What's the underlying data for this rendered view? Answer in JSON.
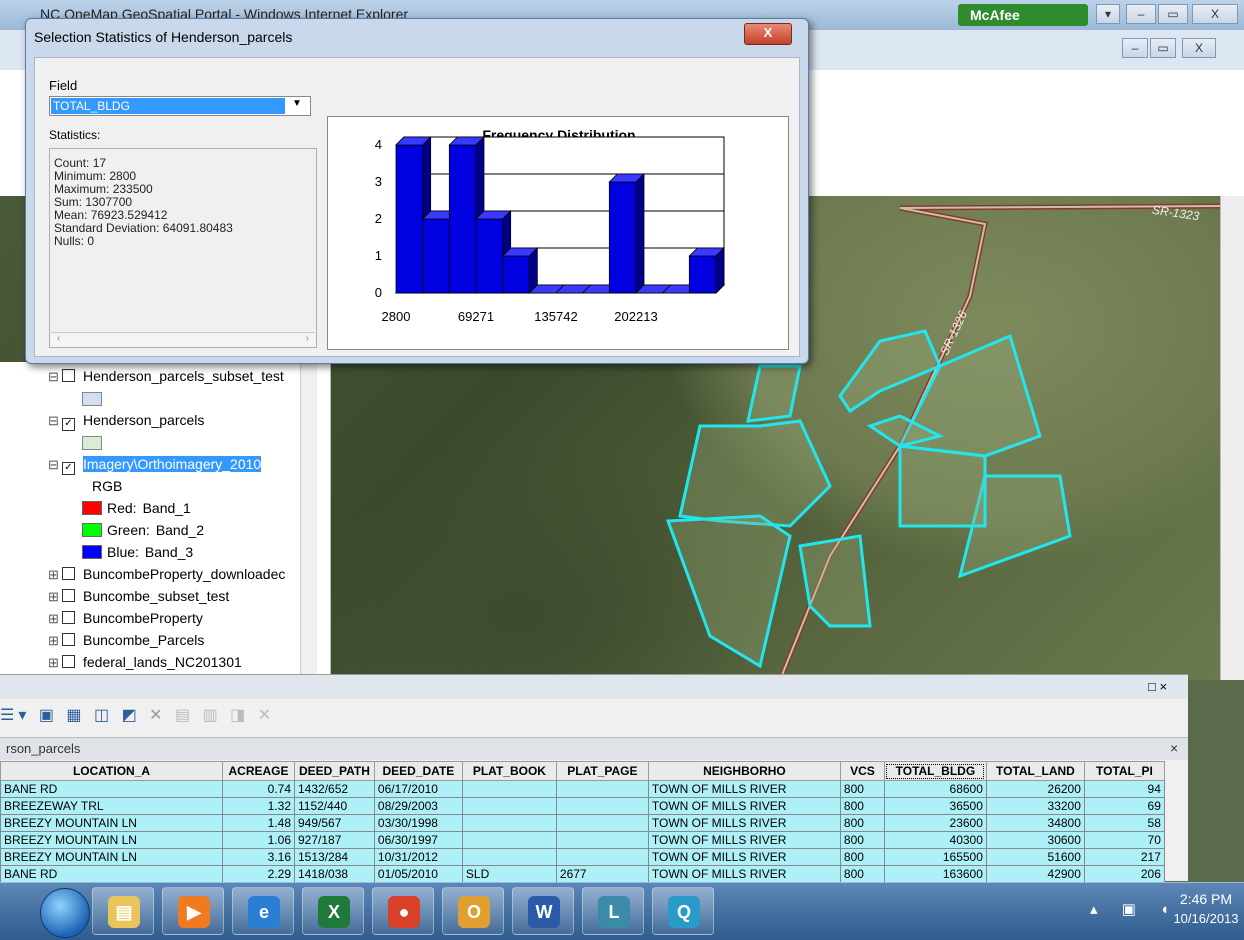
{
  "browser": {
    "title": "NC OneMap GeoSpatial Portal - Windows Internet Explorer",
    "mcafee_label": "McAfee",
    "controls": {
      "minimize": "–",
      "restore": "▭",
      "close": "X"
    }
  },
  "map": {
    "road_labels": [
      "SR-1323",
      "SR-1326"
    ]
  },
  "dialog": {
    "title": "Selection Statistics of Henderson_parcels",
    "close_label": "X",
    "field_label": "Field",
    "field_value": "TOTAL_BLDG",
    "statistics_label": "Statistics:",
    "stats": [
      {
        "label": "Count:",
        "value": "17"
      },
      {
        "label": "Minimum:",
        "value": "2800"
      },
      {
        "label": "Maximum:",
        "value": "233500"
      },
      {
        "label": "Sum:",
        "value": "1307700"
      },
      {
        "label": "Mean:",
        "value": "76923.529412"
      },
      {
        "label": "Standard Deviation:",
        "value": "64091.80483"
      },
      {
        "label": "Nulls:",
        "value": "0"
      }
    ]
  },
  "chart_data": {
    "type": "bar",
    "title": "Frequency Distribution",
    "values": [
      4,
      2,
      4,
      2,
      1,
      0,
      0,
      0,
      3,
      0,
      0,
      1
    ],
    "y_ticks": [
      0,
      1,
      2,
      3,
      4
    ],
    "ylim": [
      0,
      4
    ],
    "x_tick_labels": [
      "2800",
      "69271",
      "135742",
      "202213"
    ],
    "bar_color": "#0000e0",
    "grid": true
  },
  "toc": {
    "layers": [
      {
        "name": "Henderson_parcels_subset_test",
        "checked": false,
        "expander": "⊟",
        "swatch": "#cfe0f0"
      },
      {
        "name": "Henderson_parcels",
        "checked": true,
        "expander": "⊟",
        "swatch": "#d8ecd8"
      },
      {
        "name": "Imagery\\Orthoimagery_2010",
        "checked": true,
        "expander": "⊟",
        "selected": true
      },
      {
        "name": "BuncombeProperty_downloadec",
        "checked": false,
        "expander": "⊞"
      },
      {
        "name": "Buncombe_subset_test",
        "checked": false,
        "expander": "⊞"
      },
      {
        "name": "BuncombeProperty",
        "checked": false,
        "expander": "⊞"
      },
      {
        "name": "Buncombe_Parcels",
        "checked": false,
        "expander": "⊞"
      },
      {
        "name": "federal_lands_NC201301",
        "checked": false,
        "expander": "⊞"
      }
    ],
    "rgb_label": "RGB",
    "bands": [
      {
        "label": "Red:",
        "band": "Band_1",
        "color": "#ff0000"
      },
      {
        "label": "Green:",
        "band": "Band_2",
        "color": "#00ff00"
      },
      {
        "label": "Blue:",
        "band": "Band_3",
        "color": "#0000ff"
      }
    ]
  },
  "table": {
    "window_close": "□ ×",
    "tab_name": "rson_parcels",
    "tab_close": "×",
    "columns": [
      "LOCATION_A",
      "ACREAGE",
      "DEED_PATH",
      "DEED_DATE",
      "PLAT_BOOK",
      "PLAT_PAGE",
      "NEIGHBORHO",
      "VCS",
      "TOTAL_BLDG",
      "TOTAL_LAND",
      "TOTAL_PI"
    ],
    "rows": [
      [
        "BANE RD",
        "0.74",
        "1432/652",
        "06/17/2010",
        "",
        "",
        "TOWN OF MILLS RIVER",
        "800",
        "68600",
        "26200",
        "94"
      ],
      [
        "BREEZEWAY TRL",
        "1.32",
        "1152/440",
        "08/29/2003",
        "",
        "",
        "TOWN OF MILLS RIVER",
        "800",
        "36500",
        "33200",
        "69"
      ],
      [
        "BREEZY MOUNTAIN LN",
        "1.48",
        "949/567",
        "03/30/1998",
        "",
        "",
        "TOWN OF MILLS RIVER",
        "800",
        "23600",
        "34800",
        "58"
      ],
      [
        "BREEZY MOUNTAIN LN",
        "1.06",
        "927/187",
        "06/30/1997",
        "",
        "",
        "TOWN OF MILLS RIVER",
        "800",
        "40300",
        "30600",
        "70"
      ],
      [
        "BREEZY MOUNTAIN LN",
        "3.16",
        "1513/284",
        "10/31/2012",
        "",
        "",
        "TOWN OF MILLS RIVER",
        "800",
        "165500",
        "51600",
        "217"
      ],
      [
        "BANE RD",
        "2.29",
        "1418/038",
        "01/05/2010",
        "SLD",
        "2677",
        "TOWN OF MILLS RIVER",
        "800",
        "163600",
        "42900",
        "206"
      ]
    ]
  },
  "taskbar": {
    "time": "2:46 PM",
    "date": "10/16/2013",
    "apps": [
      {
        "name": "explorer",
        "color": "#e8c45a",
        "glyph": "▤"
      },
      {
        "name": "media",
        "color": "#f07a20",
        "glyph": "▶"
      },
      {
        "name": "ie",
        "color": "#2a7fd4",
        "glyph": "e"
      },
      {
        "name": "excel",
        "color": "#1f7a3a",
        "glyph": "X"
      },
      {
        "name": "chrome",
        "color": "#d9402a",
        "glyph": "●"
      },
      {
        "name": "outlook",
        "color": "#e0a030",
        "glyph": "O"
      },
      {
        "name": "word",
        "color": "#2a5aa8",
        "glyph": "W"
      },
      {
        "name": "arcgis",
        "color": "#3a8aa8",
        "glyph": "L"
      },
      {
        "name": "search",
        "color": "#2a9ac8",
        "glyph": "Q"
      }
    ]
  }
}
